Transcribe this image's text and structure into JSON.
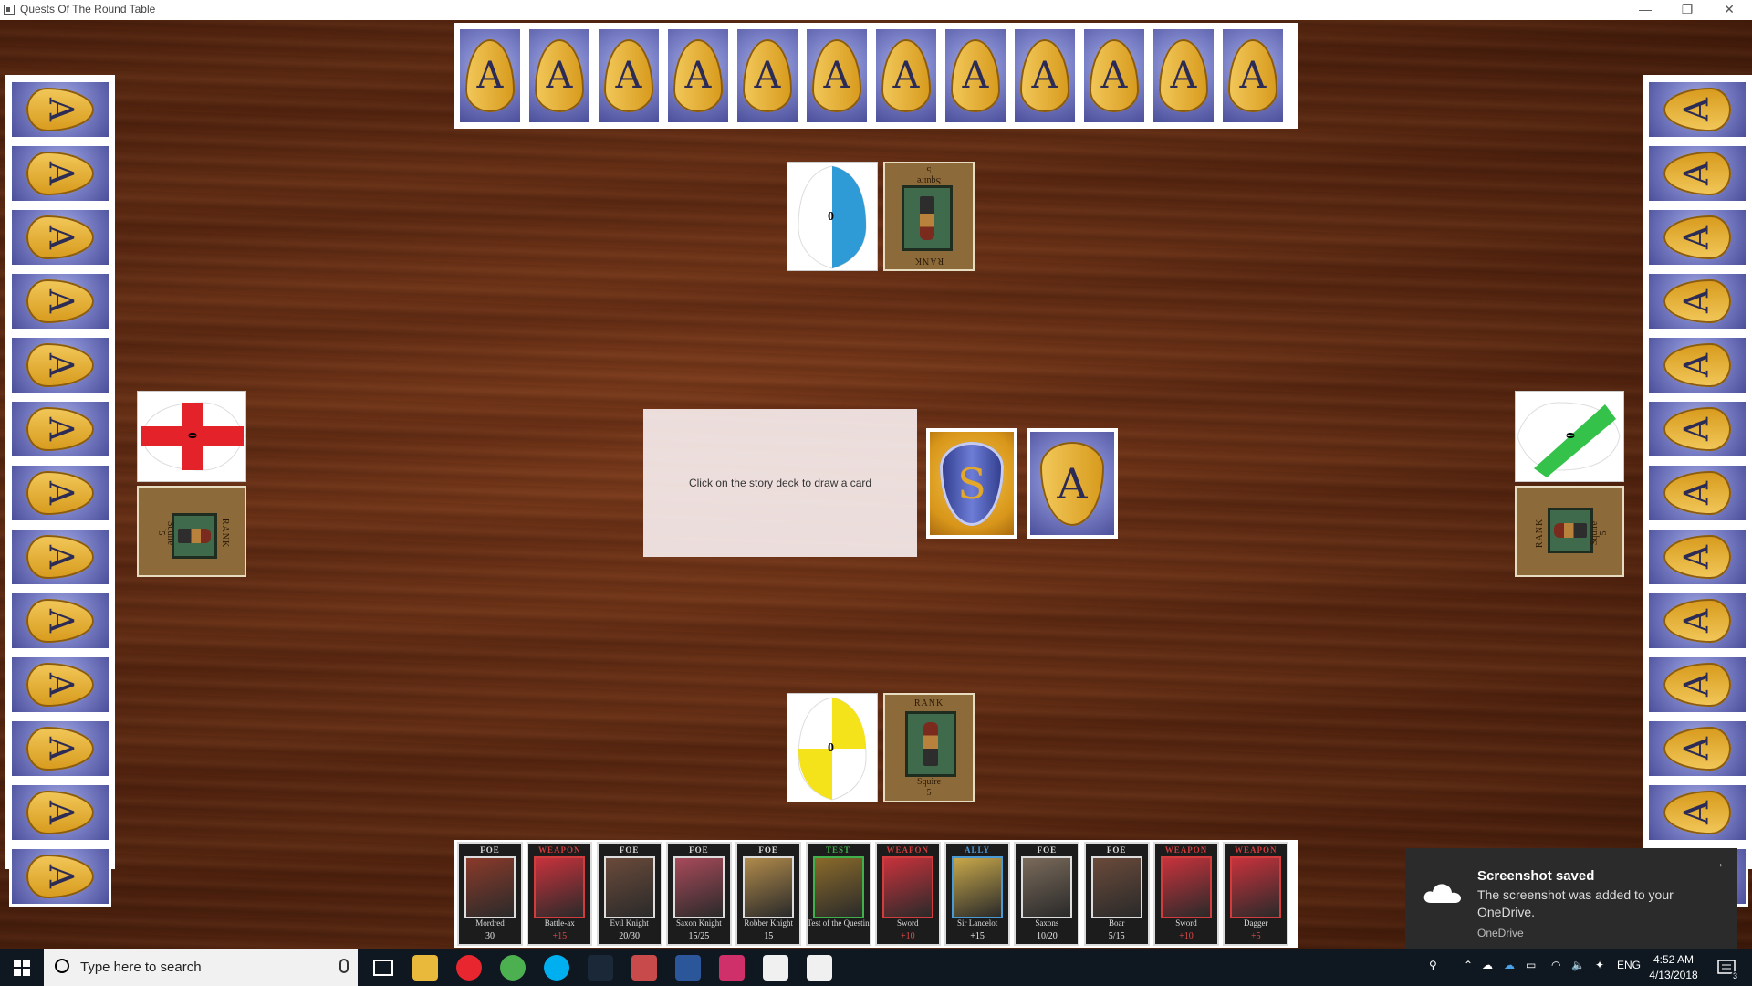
{
  "window": {
    "title": "Quests Of The Round Table",
    "minimize": "—",
    "restore": "❐",
    "close": "✕"
  },
  "colors": {
    "table_wood": "#5e2a12",
    "card_back_blue": "#7c82c8",
    "card_back_gold": "#e0a93a",
    "toast_bg": "#2b2b2b"
  },
  "deck_backs": {
    "adventure_letter": "A"
  },
  "players": {
    "top": {
      "shield_colors": [
        "#ffffff",
        "#2f9bd6"
      ],
      "shield_count": "0",
      "rank_title": "RANK",
      "rank_name": "Squire",
      "battle_points": "5"
    },
    "left": {
      "shield_colors": [
        "#ffffff",
        "#e3222a"
      ],
      "shield_count": "0",
      "rank_title": "RANK",
      "rank_name": "Squire",
      "battle_points": "5"
    },
    "right": {
      "shield_colors": [
        "#ffffff",
        "#35c24a"
      ],
      "shield_count": "0",
      "rank_title": "RANK",
      "rank_name": "Squire",
      "battle_points": "5"
    },
    "bottom": {
      "shield_colors": [
        "#ffffff",
        "#f4e21a"
      ],
      "shield_count": "0",
      "rank_title": "RANK",
      "rank_name": "Squire",
      "battle_points": "5"
    }
  },
  "message": "Click on the story deck to draw a card",
  "decks": {
    "story": {
      "letter": "S"
    },
    "adventure": {
      "letter": "A"
    }
  },
  "hand": [
    {
      "type": "FOE",
      "name": "Mordred",
      "bp": "30",
      "accent": "#dddddd",
      "art": "#8a3a2a"
    },
    {
      "type": "WEAPON",
      "name": "Battle-ax",
      "bp": "+15",
      "accent": "#d23c3c",
      "art": "#c8323c"
    },
    {
      "type": "FOE",
      "name": "Evil Knight",
      "bp": "20/30",
      "accent": "#dddddd",
      "art": "#6a4a3a"
    },
    {
      "type": "FOE",
      "name": "Saxon Knight",
      "bp": "15/25",
      "accent": "#dddddd",
      "art": "#a84a5a"
    },
    {
      "type": "FOE",
      "name": "Robber Knight",
      "bp": "15",
      "accent": "#dddddd",
      "art": "#b08a4a"
    },
    {
      "type": "TEST",
      "name": "Test of the Questing Beast",
      "bp": "",
      "accent": "#3fb04a",
      "art": "#8a6a2a"
    },
    {
      "type": "WEAPON",
      "name": "Sword",
      "bp": "+10",
      "accent": "#d23c3c",
      "art": "#c8323c"
    },
    {
      "type": "ALLY",
      "name": "Sir Lancelot",
      "bp": "+15",
      "accent": "#4a9ad6",
      "art": "#c8a84a"
    },
    {
      "type": "FOE",
      "name": "Saxons",
      "bp": "10/20",
      "accent": "#dddddd",
      "art": "#7a6a5a"
    },
    {
      "type": "FOE",
      "name": "Boar",
      "bp": "5/15",
      "accent": "#dddddd",
      "art": "#6a4a3a"
    },
    {
      "type": "WEAPON",
      "name": "Sword",
      "bp": "+10",
      "accent": "#d23c3c",
      "art": "#c8323c"
    },
    {
      "type": "WEAPON",
      "name": "Dagger",
      "bp": "+5",
      "accent": "#d23c3c",
      "art": "#c8323c"
    }
  ],
  "toast": {
    "title": "Screenshot saved",
    "body": "The screenshot was added to your OneDrive.",
    "source": "OneDrive"
  },
  "taskbar": {
    "search_placeholder": "Type here to search",
    "language": "ENG",
    "time": "4:52 AM",
    "date": "4/13/2018",
    "notification_count": "3",
    "pinned_icons": [
      "task-view-icon",
      "file-explorer-icon",
      "opera-icon",
      "chrome-icon",
      "skype-icon",
      "steam-icon",
      "bird-app-icon",
      "word-icon",
      "intellij-icon",
      "java-app-icon",
      "java-app-2-icon"
    ]
  }
}
